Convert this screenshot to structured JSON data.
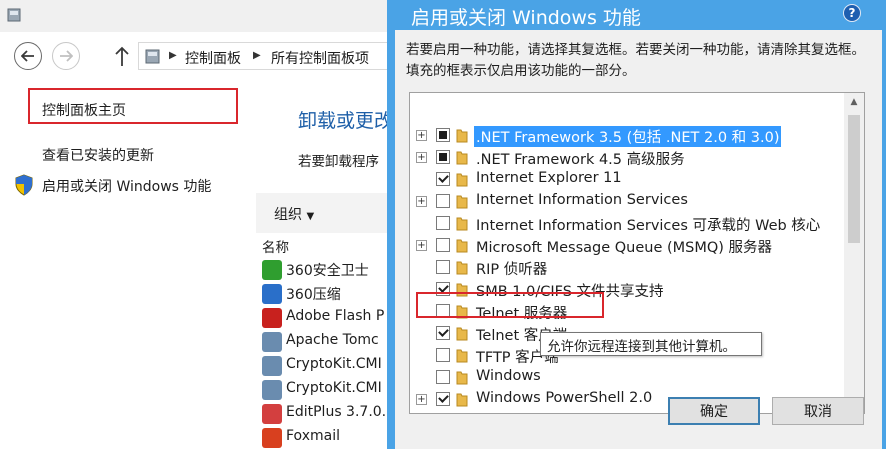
{
  "control_panel": {
    "breadcrumbs": [
      "控制面板",
      "所有控制面板项"
    ],
    "left_links": [
      "控制面板主页",
      "查看已安装的更新",
      "启用或关闭 Windows 功能"
    ],
    "heading": "卸载或更改",
    "description": "若要卸载程序",
    "toolbar_organize": "组织",
    "column_name": "名称",
    "programs": [
      {
        "name": "360安全卫士",
        "color": "#2f9e2f"
      },
      {
        "name": "360压缩",
        "color": "#2a6fc9"
      },
      {
        "name": "Adobe Flash P",
        "color": "#c8211e"
      },
      {
        "name": "Apache Tomc",
        "color": "#6a8caf"
      },
      {
        "name": "CryptoKit.CMI",
        "color": "#6a8caf"
      },
      {
        "name": "CryptoKit.CMI",
        "color": "#6a8caf"
      },
      {
        "name": "EditPlus 3.7.0.",
        "color": "#d33f3f"
      },
      {
        "name": "Foxmail",
        "color": "#d8401f"
      }
    ]
  },
  "dialog": {
    "title": "启用或关闭 Windows 功能",
    "help_label": "?",
    "description": "若要启用一种功能，请选择其复选框。若要关闭一种功能，请清除其复选框。填充的框表示仅启用该功能的一部分。",
    "features": [
      {
        "label": ".NET Framework 3.5 (包括 .NET 2.0 和 3.0)",
        "state": "partial",
        "expandable": true,
        "selected": true
      },
      {
        "label": ".NET Framework 4.5 高级服务",
        "state": "partial",
        "expandable": true,
        "selected": false
      },
      {
        "label": "Internet Explorer 11",
        "state": "checked",
        "expandable": false,
        "selected": false
      },
      {
        "label": "Internet Information Services",
        "state": "unchecked",
        "expandable": true,
        "selected": false
      },
      {
        "label": "Internet Information Services 可承载的 Web 核心",
        "state": "unchecked",
        "expandable": false,
        "selected": false
      },
      {
        "label": "Microsoft Message Queue (MSMQ) 服务器",
        "state": "unchecked",
        "expandable": true,
        "selected": false
      },
      {
        "label": "RIP 侦听器",
        "state": "unchecked",
        "expandable": false,
        "selected": false
      },
      {
        "label": "SMB 1.0/CIFS 文件共享支持",
        "state": "checked",
        "expandable": false,
        "selected": false
      },
      {
        "label": "Telnet 服务器",
        "state": "unchecked",
        "expandable": false,
        "selected": false
      },
      {
        "label": "Telnet 客户端",
        "state": "checked",
        "expandable": false,
        "selected": false
      },
      {
        "label": "TFTP 客户端",
        "state": "unchecked",
        "expandable": false,
        "selected": false
      },
      {
        "label": "Windows",
        "state": "unchecked",
        "expandable": false,
        "selected": false
      },
      {
        "label": "Windows PowerShell 2.0",
        "state": "checked",
        "expandable": true,
        "selected": false
      }
    ],
    "tooltip": "允许你远程连接到其他计算机。",
    "ok_label": "确定",
    "cancel_label": "取消"
  },
  "colors": {
    "dialog_frame": "#4aa3e6",
    "highlight_box": "#d9262c",
    "selection": "#3399ff",
    "heading_link": "#1e5fa8"
  }
}
